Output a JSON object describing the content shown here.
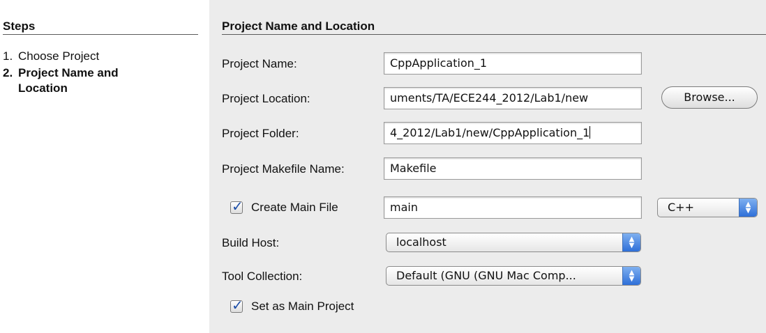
{
  "steps": {
    "title": "Steps",
    "items": [
      {
        "num": "1.",
        "label": "Choose Project"
      },
      {
        "num": "2.",
        "label": "Project Name and Location"
      }
    ]
  },
  "panel": {
    "title": "Project Name and Location",
    "project_name": {
      "label": "Project Name:",
      "value": "CppApplication_1"
    },
    "project_location": {
      "label": "Project Location:",
      "value": "uments/TA/ECE244_2012/Lab1/new"
    },
    "browse_label": "Browse...",
    "project_folder": {
      "label": "Project Folder:",
      "value": "4_2012/Lab1/new/CppApplication_1"
    },
    "makefile": {
      "label": "Project Makefile Name:",
      "value": "Makefile"
    },
    "create_main": {
      "label": "Create Main File",
      "checked": true,
      "value": "main",
      "language": "C++"
    },
    "build_host": {
      "label": "Build Host:",
      "value": "localhost"
    },
    "tool_collection": {
      "label": "Tool Collection:",
      "value": "Default (GNU (GNU Mac Comp..."
    },
    "set_main": {
      "label": "Set as Main Project",
      "checked": true
    }
  },
  "colors": {
    "panel_bg": "#ececec",
    "popup_arrow": "#2e6fd8",
    "check_mark": "#1e4fa8"
  }
}
